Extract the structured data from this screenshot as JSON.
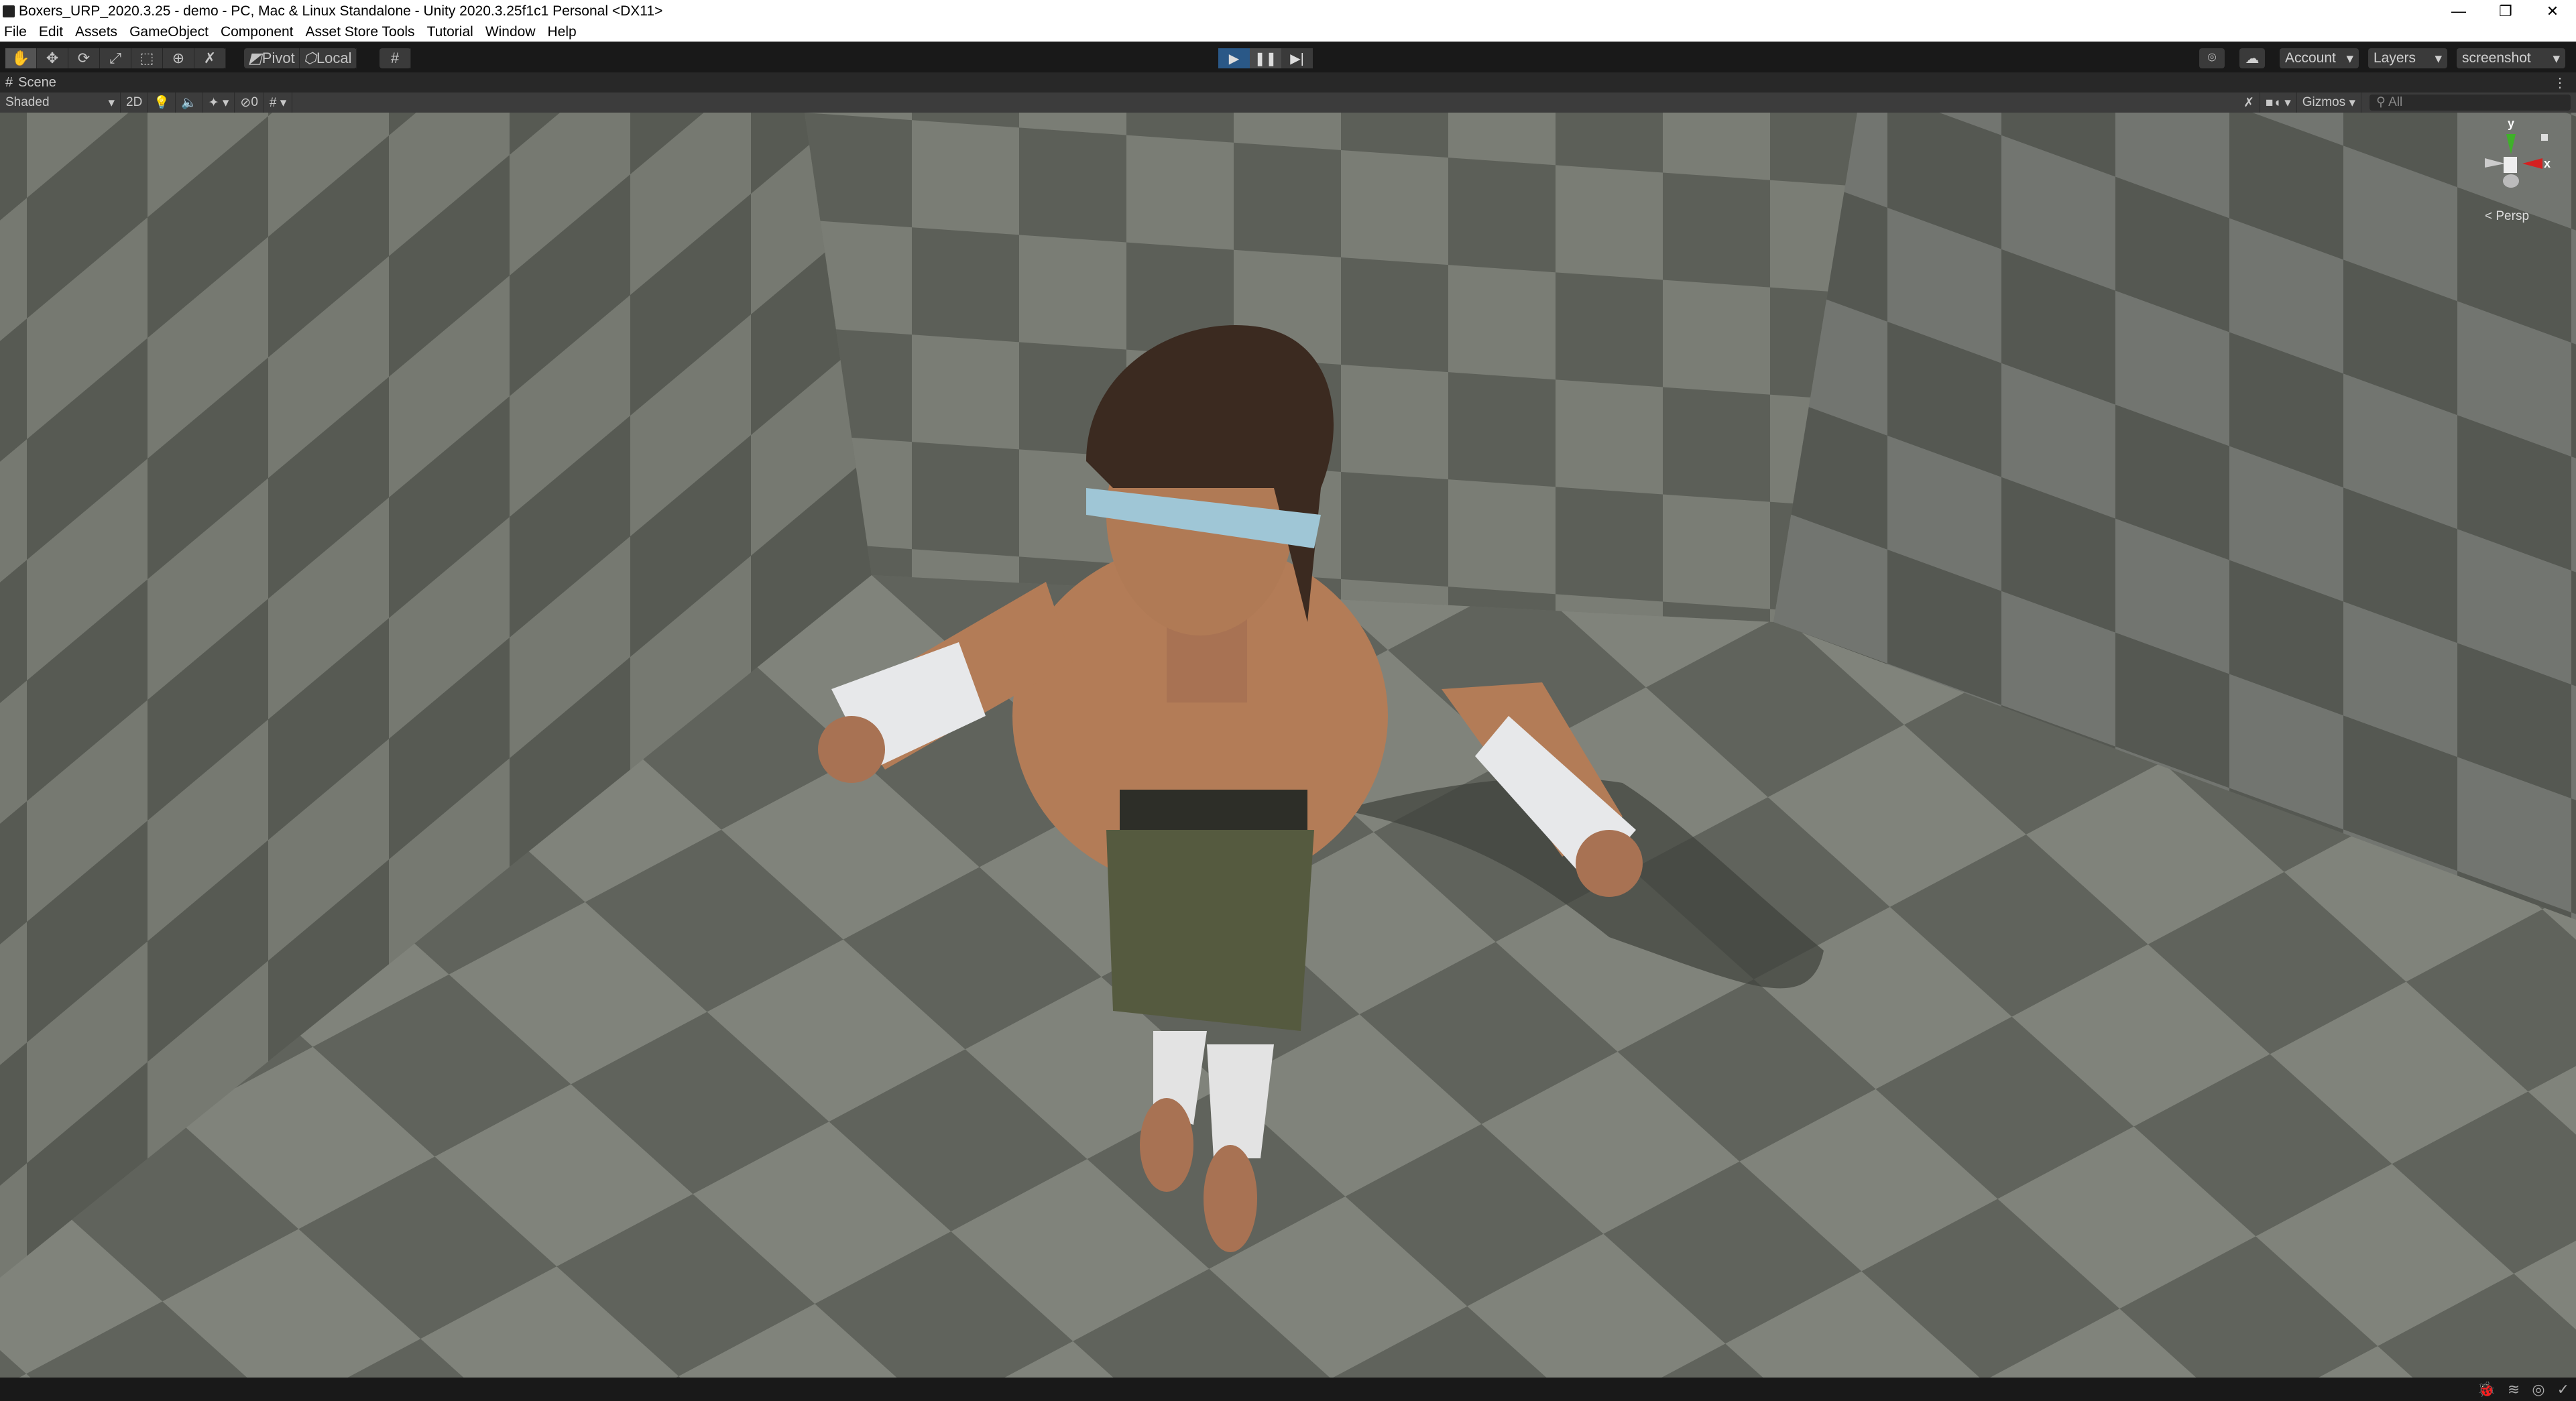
{
  "window": {
    "title": "Boxers_URP_2020.3.25 - demo - PC, Mac & Linux Standalone - Unity 2020.3.25f1c1 Personal <DX11>",
    "minimize": "—",
    "restore": "❐",
    "close": "✕"
  },
  "menu": [
    "File",
    "Edit",
    "Assets",
    "GameObject",
    "Component",
    "Asset Store Tools",
    "Tutorial",
    "Window",
    "Help"
  ],
  "toolbar": {
    "pivot": "Pivot",
    "local": "Local",
    "account": "Account",
    "layers": "Layers",
    "layout": "screenshot"
  },
  "scene": {
    "tab": "Scene",
    "shading": "Shaded",
    "mode2d": "2D",
    "hidden_count": "0",
    "gizmos": "Gizmos",
    "search_placeholder": "All",
    "projection": "Persp",
    "axis_x": "x",
    "axis_y": "y"
  }
}
